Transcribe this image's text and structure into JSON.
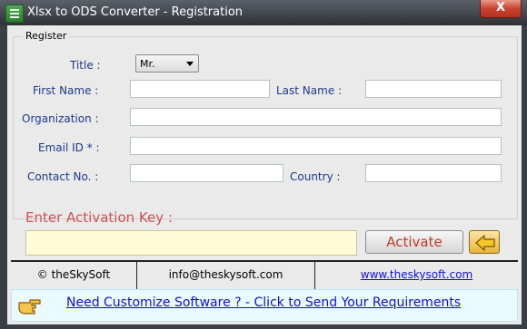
{
  "window": {
    "title": "Xlsx to ODS Converter - Registration",
    "close_glyph": "X",
    "app_icon": "spreadsheet-icon"
  },
  "register": {
    "legend": "Register",
    "title_label": "Title :",
    "title_value": "Mr.",
    "first_name_label": "First Name :",
    "last_name_label": "Last Name :",
    "organization_label": "Organization :",
    "email_label": "Email ID * :",
    "contact_label": "Contact No. :",
    "country_label": "Country :"
  },
  "activation": {
    "label": "Enter Activation Key  :",
    "key_value": "",
    "activate_label": "Activate",
    "back_icon": "arrow-left-icon"
  },
  "footer": {
    "company": "© theSkySoft",
    "email": "info@theskysoft.com",
    "website": "www.theskysoft.com"
  },
  "bottom": {
    "icon": "pointing-hand-icon",
    "link_text": "Need Customize Software ? - Click to Send Your Requirements"
  },
  "colors": {
    "label_blue": "#1e3a8a",
    "activation_red": "#d05050",
    "link_blue": "#1010d0",
    "key_bg": "#fffbd6"
  }
}
